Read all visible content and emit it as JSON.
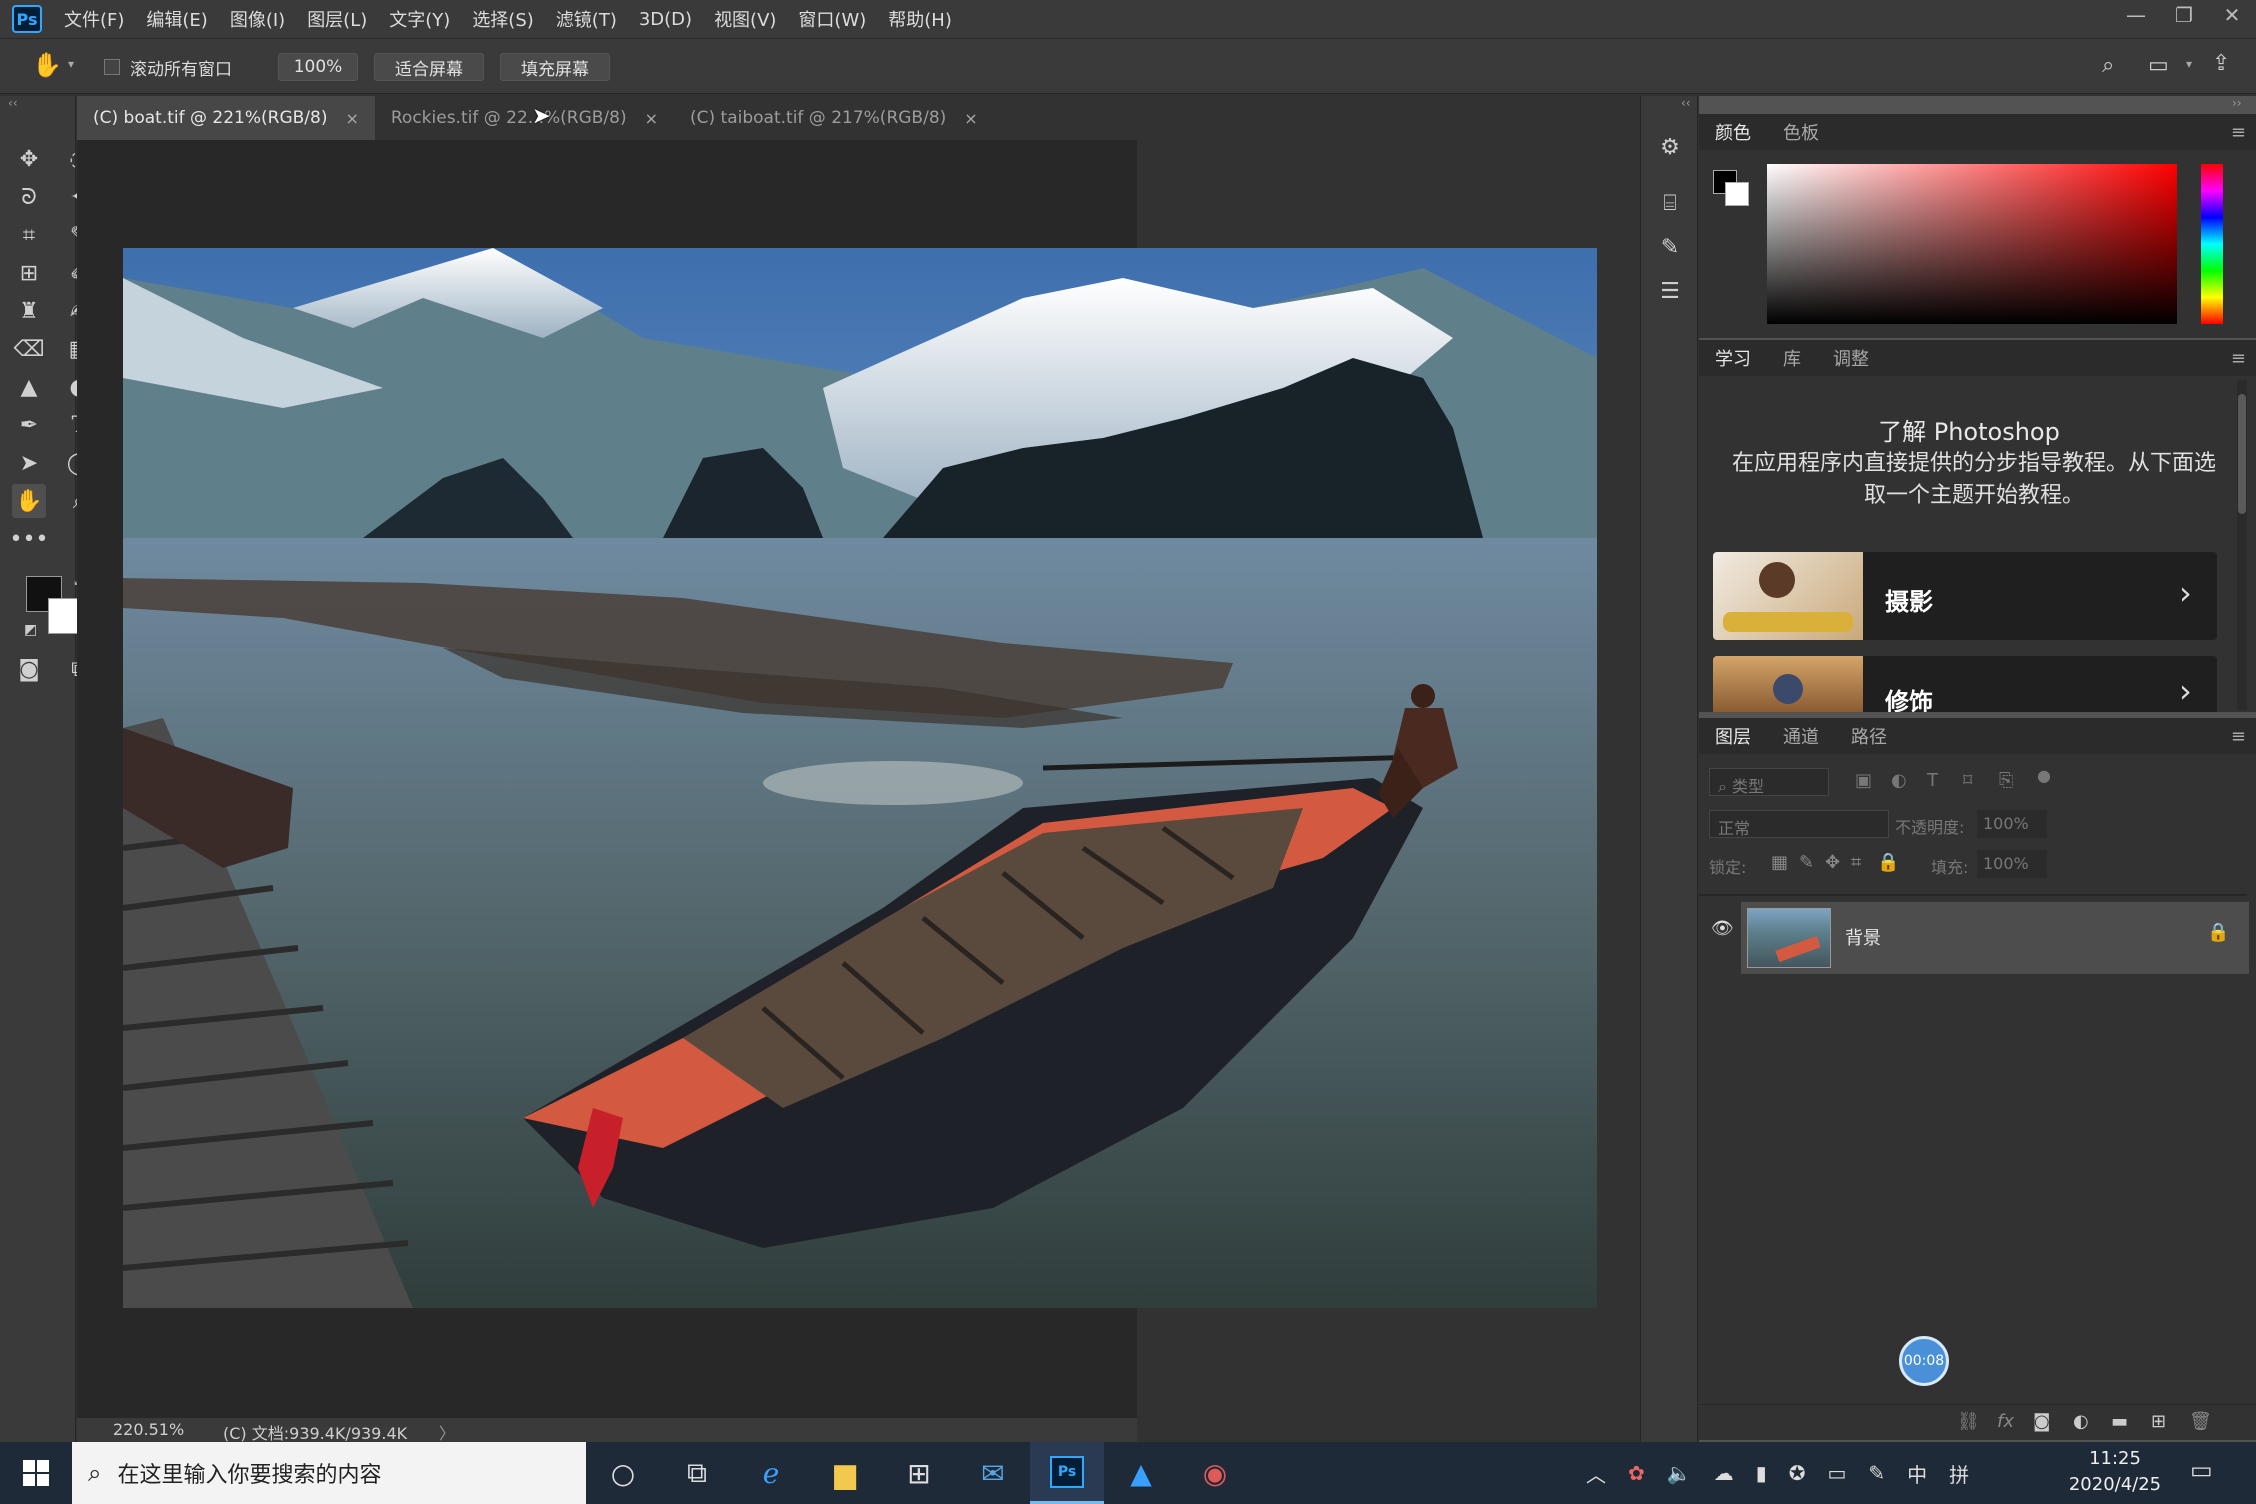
{
  "app": {
    "logo": "Ps",
    "menu": [
      "文件(F)",
      "编辑(E)",
      "图像(I)",
      "图层(L)",
      "文字(Y)",
      "选择(S)",
      "滤镜(T)",
      "3D(D)",
      "视图(V)",
      "窗口(W)",
      "帮助(H)"
    ]
  },
  "options": {
    "scroll_all_label": "滚动所有窗口",
    "zoom_value": "100%",
    "fit_screen": "适合屏幕",
    "fill_screen": "填充屏幕"
  },
  "tabs": [
    {
      "label": "(C) boat.tif @ 221%(RGB/8)",
      "close": "×"
    },
    {
      "label": "Rockies.tif @ 22...%(RGB/8)",
      "close": "×"
    },
    {
      "label": "(C) taiboat.tif @ 217%(RGB/8)",
      "close": "×"
    }
  ],
  "status": {
    "zoom": "220.51%",
    "doc": "(C) 文档:939.4K/939.4K",
    "arrow": "〉"
  },
  "color_panel": {
    "tabs": [
      "颜色",
      "色板"
    ],
    "hue_gradient": "#ff0000"
  },
  "learn_panel": {
    "tabs": [
      "学习",
      "库",
      "调整"
    ],
    "title": "了解 Photoshop",
    "description": "在应用程序内直接提供的分步指导教程。从下面选取一个主题开始教程。",
    "cards": [
      {
        "label": "摄影"
      },
      {
        "label": "修饰"
      }
    ]
  },
  "layers_panel": {
    "tabs": [
      "图层",
      "通道",
      "路径"
    ],
    "filter_placeholder": "类型",
    "blend_mode": "正常",
    "opacity_label": "不透明度:",
    "opacity_value": "100%",
    "lock_label": "锁定:",
    "fill_label": "填充:",
    "fill_value": "100%",
    "layers": [
      {
        "name": "背景"
      }
    ],
    "timer": "00:08",
    "footer_icons": [
      "link-icon",
      "fx-icon",
      "mask-icon",
      "adjustment-icon",
      "folder-icon",
      "new-layer-icon",
      "trash-icon"
    ]
  },
  "taskbar": {
    "search_placeholder": "在这里输入你要搜索的内容",
    "ime": "中",
    "ime2": "拼",
    "time": "11:25",
    "date": "2020/4/25"
  },
  "colors": {
    "accent": "#31a8ff",
    "ui_bg": "#323232",
    "taskbar": "#1f2a38"
  }
}
